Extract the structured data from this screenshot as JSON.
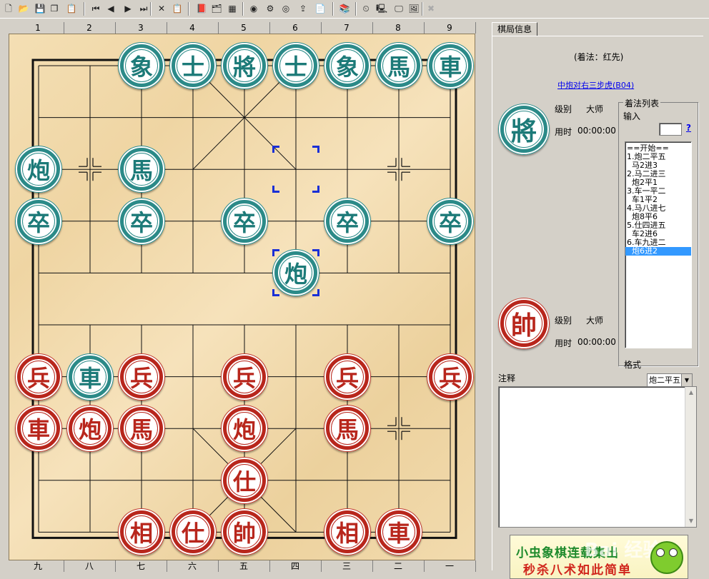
{
  "toolbar": {
    "icons": [
      "new-file-icon",
      "open-folder-icon",
      "save-icon",
      "copy-icon",
      "properties-icon",
      "first-move-icon",
      "prev-move-icon",
      "next-move-icon",
      "last-move-icon",
      "delete-icon",
      "paste-icon",
      "book-icon",
      "tree-icon",
      "grid-icon",
      "color-wheel-icon",
      "engine-icon",
      "weibo-icon",
      "export-icon",
      "clipboard-icon",
      "library-icon",
      "clock-icon",
      "computer-icon",
      "monitor-icon",
      "chart-icon",
      "close-circle-icon"
    ],
    "glyphs": [
      "🗋",
      "📂",
      "💾",
      "❐",
      "📋",
      "⏮",
      "◀",
      "▶",
      "⏭",
      "✕",
      "📋",
      "📕",
      "🗂",
      "▦",
      "◉",
      "⚙",
      "◎",
      "⇪",
      "📄",
      "📚",
      "⏲",
      "🖳",
      "🖵",
      "🖼",
      "✖"
    ]
  },
  "ruler": {
    "top": [
      "1",
      "2",
      "3",
      "4",
      "5",
      "6",
      "7",
      "8",
      "9"
    ],
    "bottom": [
      "九",
      "八",
      "七",
      "六",
      "五",
      "四",
      "三",
      "二",
      "一"
    ]
  },
  "pieces": [
    {
      "side": "blk",
      "ch": "象",
      "col": 3,
      "row": 1
    },
    {
      "side": "blk",
      "ch": "士",
      "col": 4,
      "row": 1
    },
    {
      "side": "blk",
      "ch": "將",
      "col": 5,
      "row": 1
    },
    {
      "side": "blk",
      "ch": "士",
      "col": 6,
      "row": 1
    },
    {
      "side": "blk",
      "ch": "象",
      "col": 7,
      "row": 1
    },
    {
      "side": "blk",
      "ch": "馬",
      "col": 8,
      "row": 1
    },
    {
      "side": "blk",
      "ch": "車",
      "col": 9,
      "row": 1
    },
    {
      "side": "blk",
      "ch": "炮",
      "col": 1,
      "row": 3
    },
    {
      "side": "blk",
      "ch": "馬",
      "col": 3,
      "row": 3
    },
    {
      "side": "blk",
      "ch": "卒",
      "col": 1,
      "row": 4
    },
    {
      "side": "blk",
      "ch": "卒",
      "col": 3,
      "row": 4
    },
    {
      "side": "blk",
      "ch": "卒",
      "col": 5,
      "row": 4
    },
    {
      "side": "blk",
      "ch": "卒",
      "col": 7,
      "row": 4
    },
    {
      "side": "blk",
      "ch": "卒",
      "col": 9,
      "row": 4
    },
    {
      "side": "blk",
      "ch": "炮",
      "col": 6,
      "row": 5
    },
    {
      "side": "red",
      "ch": "兵",
      "col": 1,
      "row": 7
    },
    {
      "side": "blk",
      "ch": "車",
      "col": 2,
      "row": 7
    },
    {
      "side": "red",
      "ch": "兵",
      "col": 3,
      "row": 7
    },
    {
      "side": "red",
      "ch": "兵",
      "col": 5,
      "row": 7
    },
    {
      "side": "red",
      "ch": "兵",
      "col": 7,
      "row": 7
    },
    {
      "side": "red",
      "ch": "兵",
      "col": 9,
      "row": 7
    },
    {
      "side": "red",
      "ch": "車",
      "col": 1,
      "row": 8
    },
    {
      "side": "red",
      "ch": "炮",
      "col": 2,
      "row": 8
    },
    {
      "side": "red",
      "ch": "馬",
      "col": 3,
      "row": 8
    },
    {
      "side": "red",
      "ch": "炮",
      "col": 5,
      "row": 8
    },
    {
      "side": "red",
      "ch": "馬",
      "col": 7,
      "row": 8
    },
    {
      "side": "red",
      "ch": "仕",
      "col": 5,
      "row": 9
    },
    {
      "side": "red",
      "ch": "相",
      "col": 3,
      "row": 10
    },
    {
      "side": "red",
      "ch": "仕",
      "col": 4,
      "row": 10
    },
    {
      "side": "red",
      "ch": "帥",
      "col": 5,
      "row": 10
    },
    {
      "side": "red",
      "ch": "相",
      "col": 7,
      "row": 10
    },
    {
      "side": "red",
      "ch": "車",
      "col": 8,
      "row": 10
    }
  ],
  "selection": {
    "from": {
      "col": 6,
      "row": 3
    },
    "to": {
      "col": 6,
      "row": 5
    }
  },
  "panel": {
    "tab": "棋局信息",
    "move_order": "(着法：红先)",
    "opening": "中炮对右三步虎(B04)",
    "black": {
      "piece": "將",
      "level_label": "级别",
      "level": "大师",
      "time_label": "用时",
      "time": "00:00:00"
    },
    "red": {
      "piece": "帥",
      "level_label": "级别",
      "level": "大师",
      "time_label": "用时",
      "time": "00:00:00"
    },
    "movelist_title": "着法列表",
    "input_label": "输入",
    "help": "?",
    "moves": [
      "==开始==",
      "1.炮二平五",
      "  马2进3",
      "2.马二进三",
      "  炮2平1",
      "3.车一平二",
      "  车1平2",
      "4.马八进七",
      "  炮8平6",
      "5.仕四进五",
      "  车2进6",
      "6.车九进二",
      "  炮6进2"
    ],
    "active_move": 12,
    "format_label": "格式",
    "format_value": "炮二平五",
    "notes_label": "注释",
    "ad": {
      "line1": "小虫象棋连载集出",
      "line2": "秒杀八术如此简单",
      "watermark": "Bai 经验"
    }
  }
}
